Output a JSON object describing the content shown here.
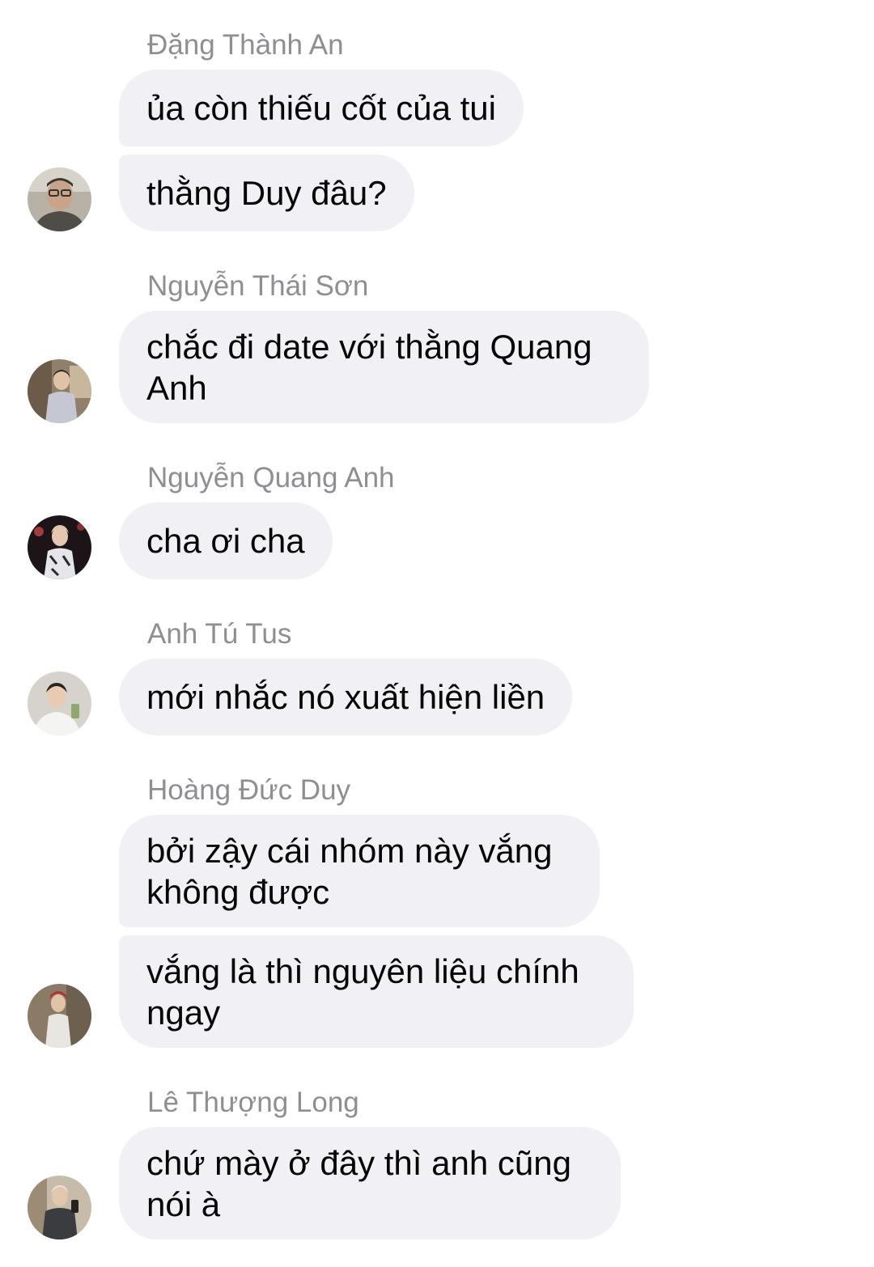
{
  "messages": [
    {
      "sender": "Đặng Thành An",
      "lines": [
        "ủa còn thiếu cốt của tui",
        "thằng Duy đâu?"
      ]
    },
    {
      "sender": "Nguyễn Thái Sơn",
      "lines": [
        "chắc đi date với thằng Quang Anh"
      ]
    },
    {
      "sender": "Nguyễn Quang Anh",
      "lines": [
        "cha ơi cha"
      ]
    },
    {
      "sender": "Anh Tú Tus",
      "lines": [
        "mới nhắc nó xuất hiện liền"
      ]
    },
    {
      "sender": "Hoàng Đức Duy",
      "lines": [
        "bởi zậy cái nhóm này vắng không được",
        "vắng là thì nguyên liệu chính ngay"
      ]
    },
    {
      "sender": "Lê Thượng Long",
      "lines": [
        "chứ mày ở đây thì anh cũng nói à"
      ]
    }
  ],
  "colors": {
    "bubble_bg": "#f0f0f5",
    "sender_text": "#8e8e93",
    "message_text": "#050505",
    "page_bg": "#ffffff"
  },
  "icons": [
    "avatar-photo"
  ]
}
